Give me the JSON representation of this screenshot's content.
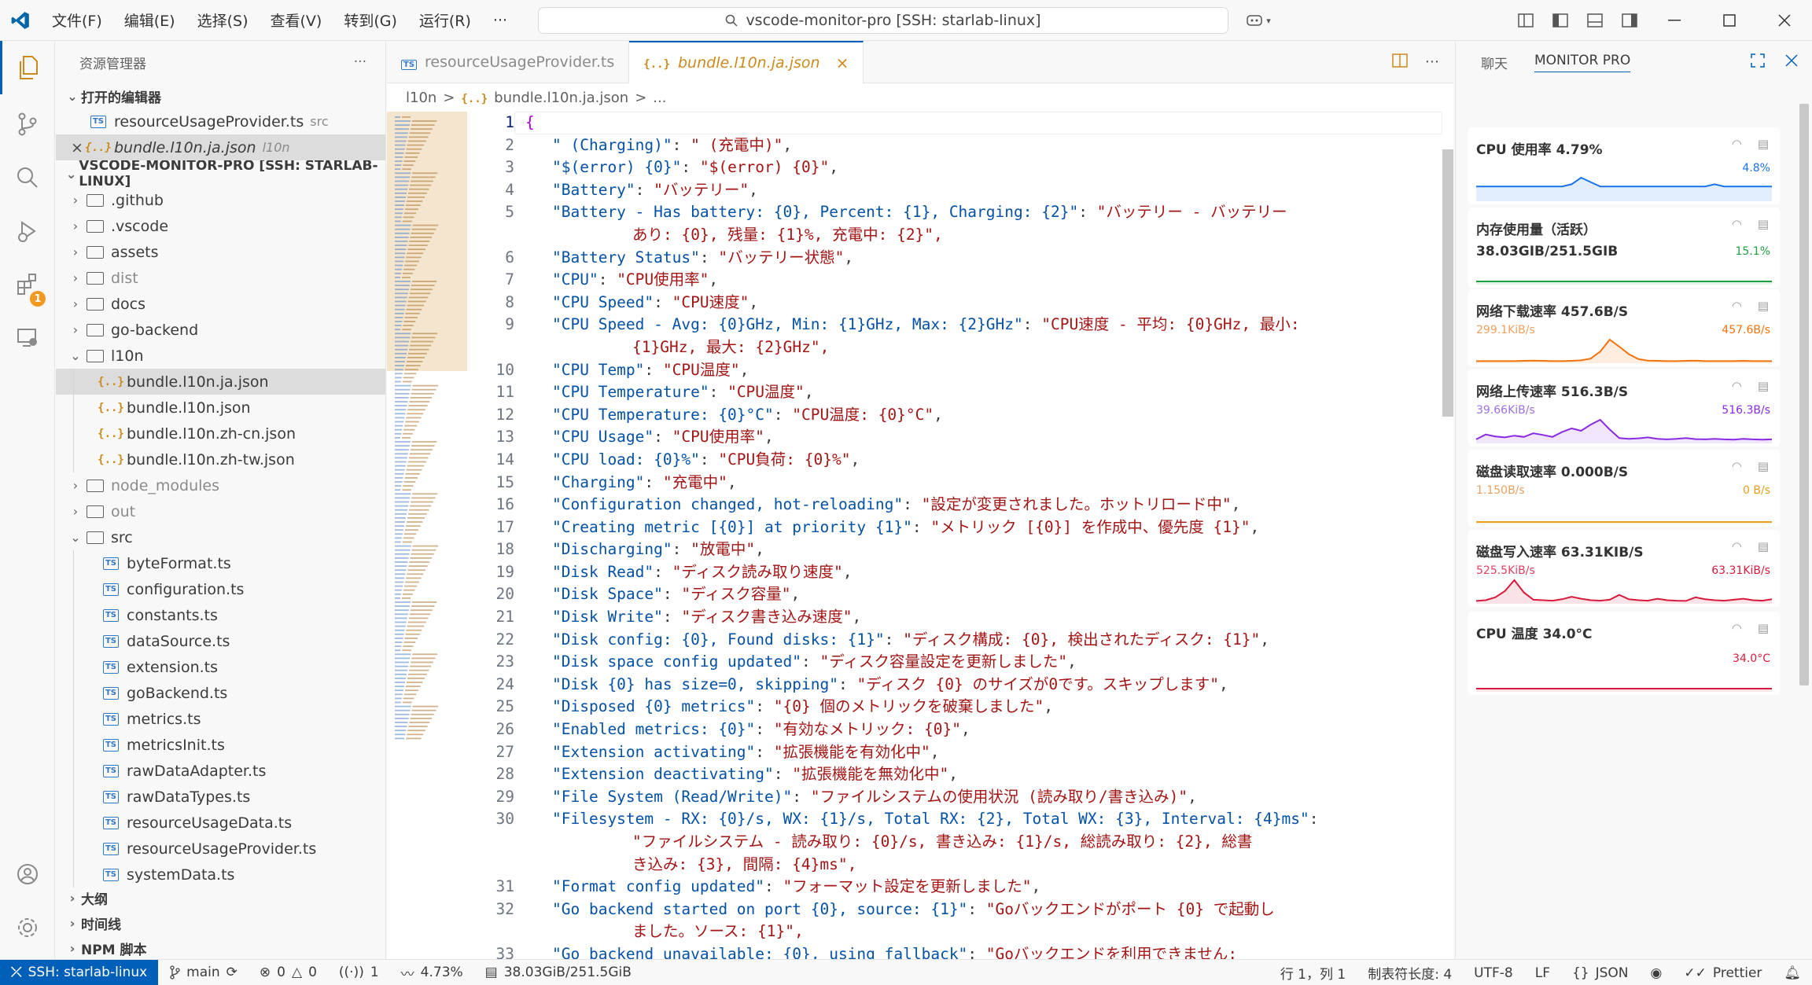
{
  "titlebar": {
    "menus": [
      "文件(F)",
      "编辑(E)",
      "选择(S)",
      "查看(V)",
      "转到(G)",
      "运行(R)",
      "···"
    ],
    "search_text": "vscode-monitor-pro [SSH: starlab-linux]"
  },
  "activity": {
    "extensions_badge": "1"
  },
  "sidebar": {
    "header": "资源管理器",
    "more": "···",
    "open_editors_title": "打开的编辑器",
    "open_editors": [
      {
        "name": "resourceUsageProvider.ts",
        "hint": "src",
        "kind": "ts"
      },
      {
        "name": "bundle.l10n.ja.json",
        "hint": "l10n",
        "kind": "json",
        "close": "×"
      }
    ],
    "workspace_title": "VSCODE-MONITOR-PRO [SSH: STARLAB-LINUX]",
    "tree": [
      {
        "name": ".github",
        "kind": "folder"
      },
      {
        "name": ".vscode",
        "kind": "folder"
      },
      {
        "name": "assets",
        "kind": "folder"
      },
      {
        "name": "dist",
        "kind": "folder",
        "dim": true
      },
      {
        "name": "docs",
        "kind": "folder"
      },
      {
        "name": "go-backend",
        "kind": "folder"
      },
      {
        "name": "l10n",
        "kind": "folder-open"
      },
      {
        "name": "bundle.l10n.ja.json",
        "kind": "json",
        "depth": 1,
        "selected": true
      },
      {
        "name": "bundle.l10n.json",
        "kind": "json",
        "depth": 1
      },
      {
        "name": "bundle.l10n.zh-cn.json",
        "kind": "json",
        "depth": 1
      },
      {
        "name": "bundle.l10n.zh-tw.json",
        "kind": "json",
        "depth": 1
      },
      {
        "name": "node_modules",
        "kind": "folder",
        "dim": true
      },
      {
        "name": "out",
        "kind": "folder",
        "dim": true
      },
      {
        "name": "src",
        "kind": "folder-open"
      },
      {
        "name": "byteFormat.ts",
        "kind": "ts",
        "depth": 1
      },
      {
        "name": "configuration.ts",
        "kind": "ts",
        "depth": 1
      },
      {
        "name": "constants.ts",
        "kind": "ts",
        "depth": 1
      },
      {
        "name": "dataSource.ts",
        "kind": "ts",
        "depth": 1
      },
      {
        "name": "extension.ts",
        "kind": "ts",
        "depth": 1
      },
      {
        "name": "goBackend.ts",
        "kind": "ts",
        "depth": 1
      },
      {
        "name": "metrics.ts",
        "kind": "ts",
        "depth": 1
      },
      {
        "name": "metricsInit.ts",
        "kind": "ts",
        "depth": 1
      },
      {
        "name": "rawDataAdapter.ts",
        "kind": "ts",
        "depth": 1
      },
      {
        "name": "rawDataTypes.ts",
        "kind": "ts",
        "depth": 1
      },
      {
        "name": "resourceUsageData.ts",
        "kind": "ts",
        "depth": 1
      },
      {
        "name": "resourceUsageProvider.ts",
        "kind": "ts",
        "depth": 1
      },
      {
        "name": "systemData.ts",
        "kind": "ts",
        "depth": 1
      }
    ],
    "bottom_sections": [
      "大纲",
      "时间线",
      "NPM 脚本"
    ]
  },
  "editor": {
    "tabs": [
      {
        "label": "resourceUsageProvider.ts",
        "kind": "ts"
      },
      {
        "label": "bundle.l10n.ja.json",
        "kind": "json",
        "active": true
      }
    ],
    "tab_close": "×",
    "tab_more": "···",
    "breadcrumbs": [
      "l10n",
      ">",
      "bundle.l10n.ja.json",
      ">",
      "..."
    ],
    "lines": [
      {
        "n": "1",
        "text": "{",
        "brace": true
      },
      {
        "n": "2",
        "key": "\" (Charging)\"",
        "val": "\" (充電中)\""
      },
      {
        "n": "3",
        "key": "\"$(error) {0}\"",
        "val": "\"$(error) {0}\""
      },
      {
        "n": "4",
        "key": "\"Battery\"",
        "val": "\"バッテリー\""
      },
      {
        "n": "5",
        "key": "\"Battery - Has battery: {0}, Percent: {1}, Charging: {2}\"",
        "val": "\"バッテリー - バッテリー"
      },
      {
        "n": "",
        "cont": "あり: {0}, 残量: {1}%, 充電中: {2}\","
      },
      {
        "n": "6",
        "key": "\"Battery Status\"",
        "val": "\"バッテリー状態\""
      },
      {
        "n": "7",
        "key": "\"CPU\"",
        "val": "\"CPU使用率\""
      },
      {
        "n": "8",
        "key": "\"CPU Speed\"",
        "val": "\"CPU速度\""
      },
      {
        "n": "9",
        "key": "\"CPU Speed - Avg: {0}GHz, Min: {1}GHz, Max: {2}GHz\"",
        "val": "\"CPU速度 - 平均: {0}GHz, 最小:"
      },
      {
        "n": "",
        "cont": "{1}GHz, 最大: {2}GHz\","
      },
      {
        "n": "10",
        "key": "\"CPU Temp\"",
        "val": "\"CPU温度\""
      },
      {
        "n": "11",
        "key": "\"CPU Temperature\"",
        "val": "\"CPU温度\""
      },
      {
        "n": "12",
        "key": "\"CPU Temperature: {0}°C\"",
        "val": "\"CPU温度: {0}°C\""
      },
      {
        "n": "13",
        "key": "\"CPU Usage\"",
        "val": "\"CPU使用率\""
      },
      {
        "n": "14",
        "key": "\"CPU load: {0}%\"",
        "val": "\"CPU負荷: {0}%\""
      },
      {
        "n": "15",
        "key": "\"Charging\"",
        "val": "\"充電中\""
      },
      {
        "n": "16",
        "key": "\"Configuration changed, hot-reloading\"",
        "val": "\"設定が変更されました。ホットリロード中\""
      },
      {
        "n": "17",
        "key": "\"Creating metric [{0}] at priority {1}\"",
        "val": "\"メトリック [{0}] を作成中、優先度 {1}\""
      },
      {
        "n": "18",
        "key": "\"Discharging\"",
        "val": "\"放電中\""
      },
      {
        "n": "19",
        "key": "\"Disk Read\"",
        "val": "\"ディスク読み取り速度\""
      },
      {
        "n": "20",
        "key": "\"Disk Space\"",
        "val": "\"ディスク容量\""
      },
      {
        "n": "21",
        "key": "\"Disk Write\"",
        "val": "\"ディスク書き込み速度\""
      },
      {
        "n": "22",
        "key": "\"Disk config: {0}, Found disks: {1}\"",
        "val": "\"ディスク構成: {0}, 検出されたディスク: {1}\""
      },
      {
        "n": "23",
        "key": "\"Disk space config updated\"",
        "val": "\"ディスク容量設定を更新しました\""
      },
      {
        "n": "24",
        "key": "\"Disk {0} has size=0, skipping\"",
        "val": "\"ディスク {0} のサイズが0です。スキップします\""
      },
      {
        "n": "25",
        "key": "\"Disposed {0} metrics\"",
        "val": "\"{0} 個のメトリックを破棄しました\""
      },
      {
        "n": "26",
        "key": "\"Enabled metrics: {0}\"",
        "val": "\"有効なメトリック: {0}\""
      },
      {
        "n": "27",
        "key": "\"Extension activating\"",
        "val": "\"拡張機能を有効化中\""
      },
      {
        "n": "28",
        "key": "\"Extension deactivating\"",
        "val": "\"拡張機能を無効化中\""
      },
      {
        "n": "29",
        "key": "\"File System (Read/Write)\"",
        "val": "\"ファイルシステムの使用状況 (読み取り/書き込み)\""
      },
      {
        "n": "30",
        "key": "\"Filesystem - RX: {0}/s, WX: {1}/s, Total RX: {2}, Total WX: {3}, Interval: {4}ms\"",
        "val": ""
      },
      {
        "n": "",
        "cont": "\"ファイルシステム - 読み取り: {0}/s, 書き込み: {1}/s, 総読み取り: {2}, 総書"
      },
      {
        "n": "",
        "cont": "き込み: {3}, 間隔: {4}ms\","
      },
      {
        "n": "31",
        "key": "\"Format config updated\"",
        "val": "\"フォーマット設定を更新しました\""
      },
      {
        "n": "32",
        "key": "\"Go backend started on port {0}, source: {1}\"",
        "val": "\"Goバックエンドがポート {0} で起動し"
      },
      {
        "n": "",
        "cont": "ました。ソース: {1}\","
      },
      {
        "n": "33",
        "key": "\"Go backend unavailable: {0}, using fallback\"",
        "val": "\"Goバックエンドを利用できません:"
      }
    ]
  },
  "panel": {
    "tabs": [
      "聊天",
      "MONITOR PRO"
    ],
    "cards": [
      {
        "title": "CPU 使用率  4.79%",
        "sub": "",
        "left": "",
        "right": "4.8%",
        "color": "#1a73e8",
        "left_color": "",
        "series": [
          3,
          3,
          3,
          3,
          3,
          3,
          3,
          3,
          3,
          3,
          3.5,
          5,
          4,
          3,
          3,
          3,
          3,
          3,
          3,
          3,
          3,
          3,
          3,
          3,
          3,
          3.5,
          3,
          3,
          3,
          3,
          3,
          3
        ]
      },
      {
        "title": "内存使用量（活跃）",
        "sub": "38.03GIB/251.5GIB",
        "left": "",
        "right": "15.1%",
        "color": "#1e9e3e",
        "left_color": "",
        "series": [
          15,
          15,
          15,
          15,
          15,
          15,
          15,
          15,
          15,
          15,
          15,
          15,
          15,
          15,
          15,
          15,
          15,
          15,
          15,
          15,
          15,
          15,
          15,
          15,
          15,
          15,
          15,
          15,
          15,
          15,
          15,
          15
        ]
      },
      {
        "title": "网络下载速率  457.6B/S",
        "sub": "",
        "left": "299.1KiB/s",
        "right": "457.6B/s",
        "color": "#f2730c",
        "left_color": "#f2a060",
        "series": [
          2,
          2,
          2,
          2,
          2,
          3,
          4,
          3,
          2,
          2,
          3,
          5,
          12,
          40,
          88,
          60,
          30,
          10,
          4,
          3,
          2,
          2,
          3,
          4,
          2,
          2,
          2,
          2,
          3,
          2,
          2,
          2
        ]
      },
      {
        "title": "网络上传速率  516.3B/S",
        "sub": "",
        "left": "39.66KiB/s",
        "right": "516.3B/s",
        "color": "#8a2be2",
        "left_color": "#a070e0",
        "series": [
          10,
          30,
          22,
          18,
          25,
          20,
          35,
          28,
          20,
          40,
          55,
          45,
          70,
          90,
          50,
          15,
          12,
          14,
          18,
          12,
          10,
          12,
          15,
          11,
          10,
          12,
          10,
          9,
          12,
          10,
          9,
          10
        ]
      },
      {
        "title": "磁盘读取速率  0.000B/S",
        "sub": "",
        "left": "1.150B/s",
        "right": "0 B/s",
        "color": "#e8a020",
        "left_color": "#e8a060",
        "series": [
          0,
          0,
          0,
          0,
          0,
          0,
          0,
          0,
          0,
          0,
          0,
          0,
          0,
          0,
          0,
          0,
          0,
          0,
          0,
          0,
          0,
          0,
          0,
          0,
          0,
          0,
          0,
          0,
          0,
          0,
          0,
          0
        ]
      },
      {
        "title": "磁盘写入速率  63.31KIB/S",
        "sub": "",
        "left": "525.5KiB/s",
        "right": "63.31KiB/s",
        "color": "#d81b3c",
        "left_color": "#e04060",
        "series": [
          5,
          8,
          20,
          45,
          90,
          40,
          10,
          8,
          6,
          12,
          22,
          14,
          8,
          6,
          10,
          30,
          12,
          8,
          6,
          14,
          8,
          6,
          5,
          20,
          12,
          8,
          6,
          10,
          14,
          8,
          6,
          12
        ]
      },
      {
        "title": "CPU 温度  34.0°C",
        "sub": "",
        "left": "",
        "right": "34.0°C",
        "color": "#d81b3c",
        "left_color": "",
        "series": [
          34,
          34,
          34,
          34,
          34,
          34,
          34,
          34,
          34,
          34,
          34,
          34,
          34,
          34,
          34,
          34,
          34,
          34,
          34,
          34,
          34,
          34,
          34,
          34,
          34,
          34,
          34,
          34,
          34,
          34,
          34,
          34
        ]
      }
    ]
  },
  "status": {
    "remote": "SSH: starlab-linux",
    "branch": "main",
    "errors": "0",
    "warnings": "0",
    "ports": "1",
    "cpu": "4.73%",
    "mem": "38.03GiB/251.5GiB",
    "position": "行 1，列 1",
    "tab_size": "制表符长度: 4",
    "encoding": "UTF-8",
    "eol": "LF",
    "lang": "JSON",
    "prettier": "Prettier"
  }
}
